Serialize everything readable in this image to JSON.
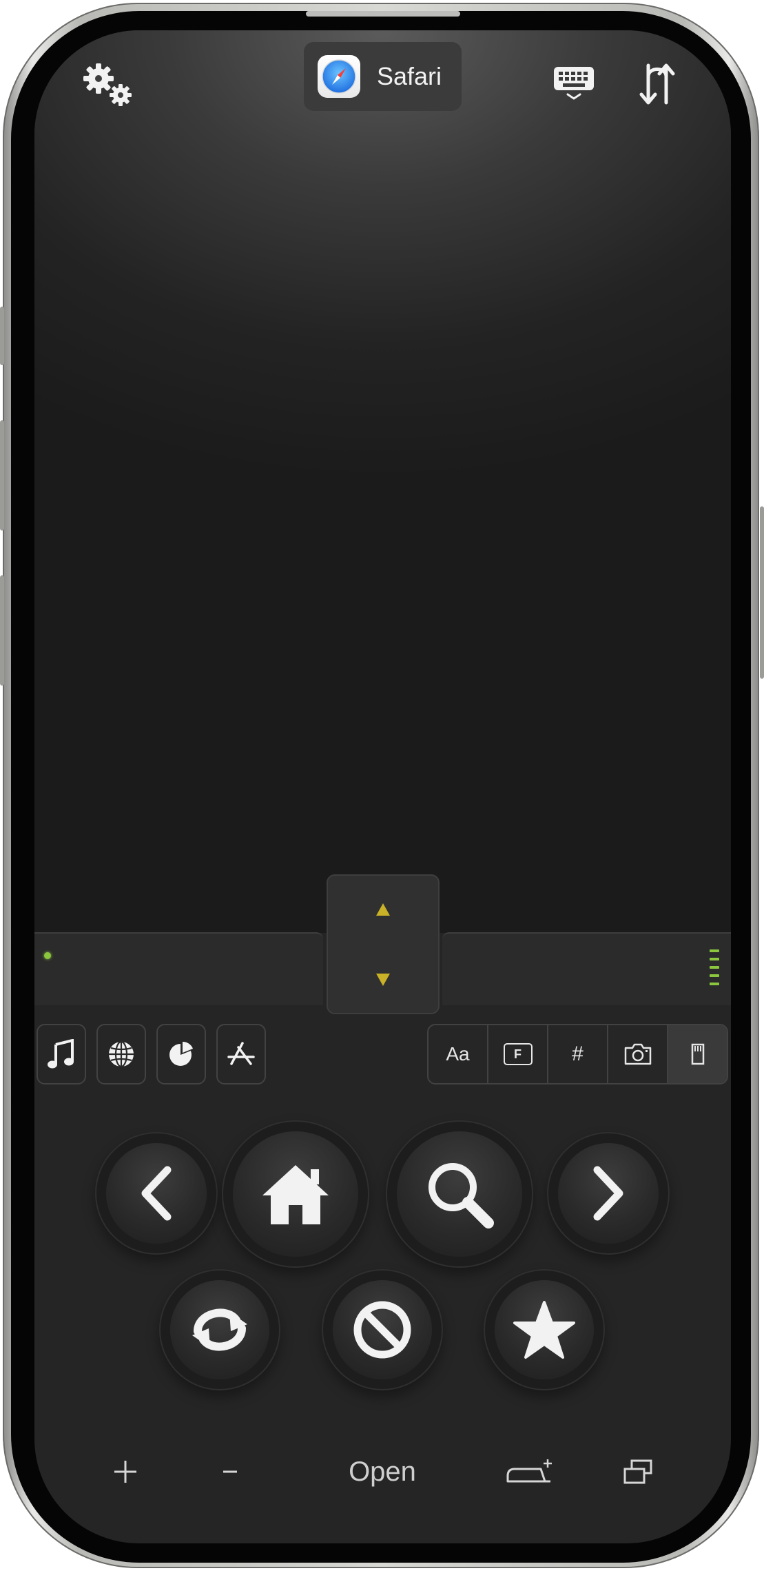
{
  "header": {
    "settings_icon": "gears-icon",
    "app_name": "Safari",
    "app_icon": "safari-compass-icon",
    "keyboard_icon": "keyboard-icon",
    "switch_icon": "swap-arrows-icon"
  },
  "scroll_control": {
    "up_icon": "triangle-up-icon",
    "down_icon": "triangle-down-icon",
    "accent_color": "#c9b227",
    "status_led_color": "#8cc63f"
  },
  "left_tools": [
    {
      "name": "music-note-icon"
    },
    {
      "name": "globe-icon"
    },
    {
      "name": "pie-chart-icon"
    },
    {
      "name": "app-store-icon"
    }
  ],
  "right_tools": {
    "font_label": "Aa",
    "f_label": "F",
    "hash_label": "#",
    "camera_icon": "camera-icon",
    "card_icon": "sd-card-icon"
  },
  "nav_buttons": {
    "back": "chevron-left-icon",
    "home": "home-icon",
    "search": "magnifier-icon",
    "forward": "chevron-right-icon",
    "reload": "reload-icon",
    "stop": "stop-icon",
    "favorite": "star-icon"
  },
  "bottom_bar": {
    "plus_label": "+",
    "minus_label": "-",
    "open_label": "Open",
    "new_tab_icon": "new-tab-icon",
    "windows_icon": "windows-icon"
  }
}
